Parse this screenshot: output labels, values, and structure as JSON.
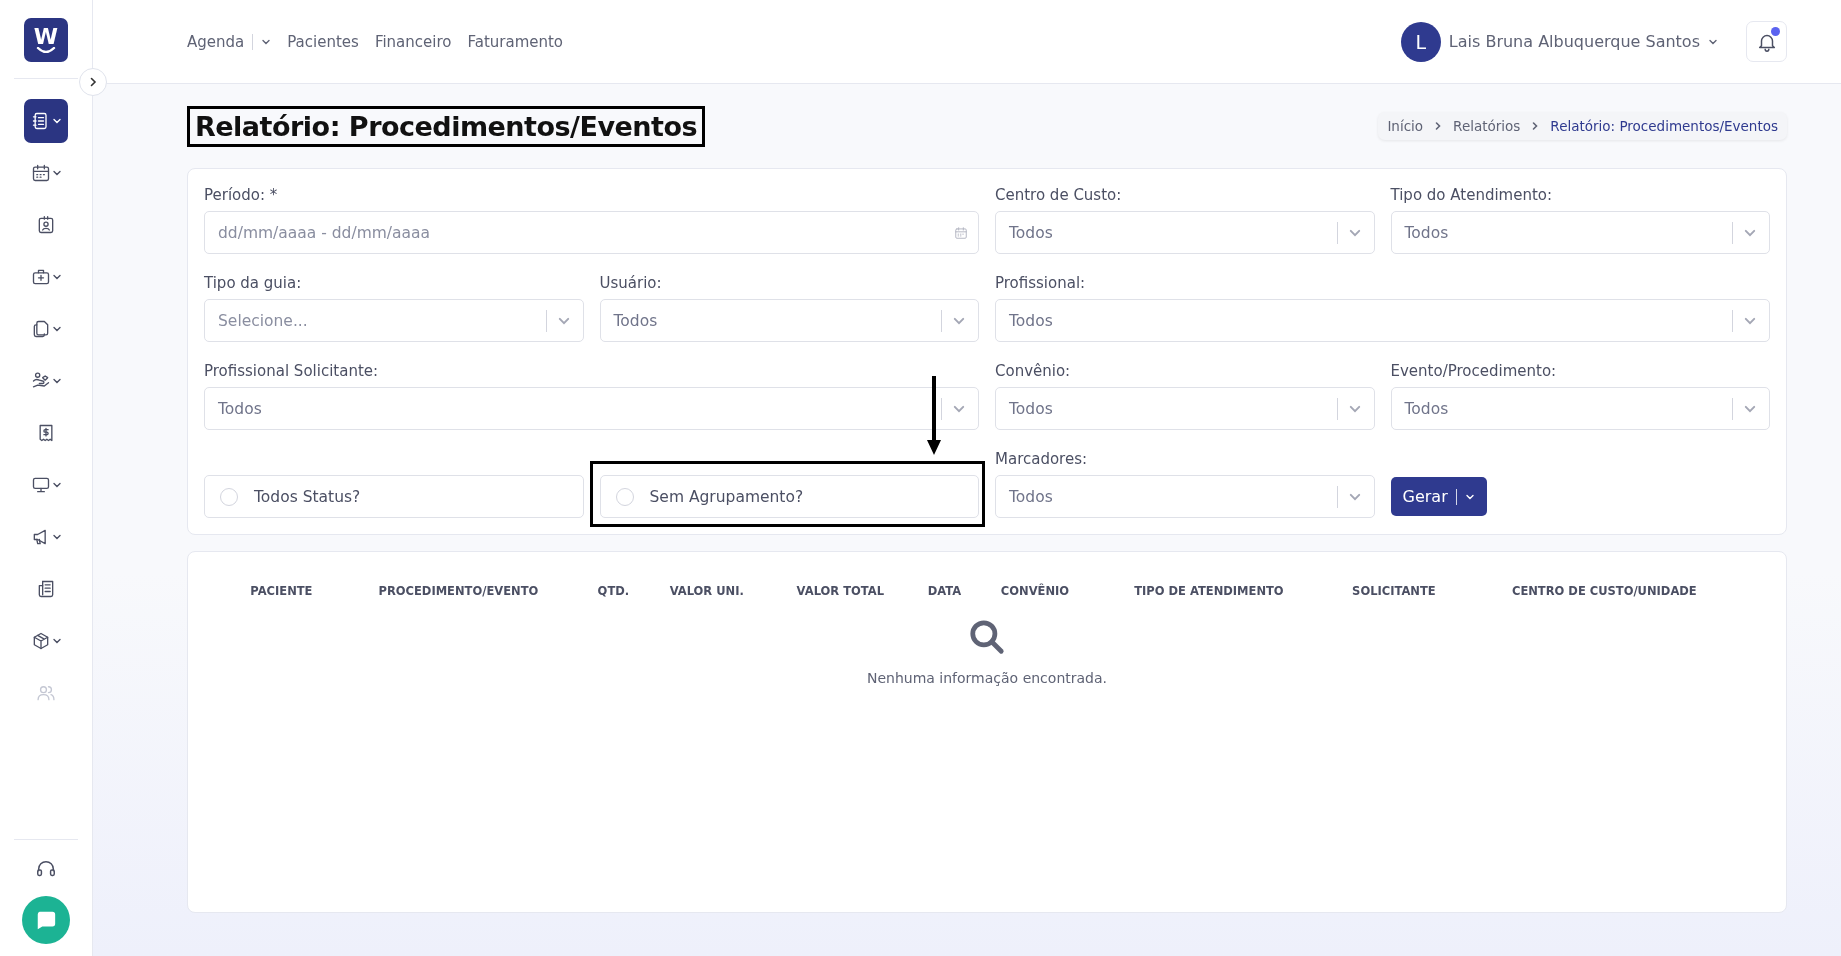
{
  "sidebar": {
    "logo": "W",
    "items": [
      {
        "selected": true,
        "submenu": true,
        "disabled": false
      },
      {
        "selected": false,
        "submenu": true,
        "disabled": false
      },
      {
        "selected": false,
        "submenu": false,
        "disabled": false
      },
      {
        "selected": false,
        "submenu": true,
        "disabled": false
      },
      {
        "selected": false,
        "submenu": true,
        "disabled": false
      },
      {
        "selected": false,
        "submenu": true,
        "disabled": false
      },
      {
        "selected": false,
        "submenu": false,
        "disabled": false
      },
      {
        "selected": false,
        "submenu": true,
        "disabled": false
      },
      {
        "selected": false,
        "submenu": true,
        "disabled": false
      },
      {
        "selected": false,
        "submenu": false,
        "disabled": false
      },
      {
        "selected": false,
        "submenu": true,
        "disabled": false
      },
      {
        "selected": false,
        "submenu": false,
        "disabled": true
      }
    ]
  },
  "nav": [
    {
      "label": "Agenda",
      "dropdown": true
    },
    {
      "label": "Pacientes",
      "dropdown": false
    },
    {
      "label": "Financeiro",
      "dropdown": false
    },
    {
      "label": "Faturamento",
      "dropdown": false
    }
  ],
  "user": {
    "initial": "L",
    "name": "Lais Bruna Albuquerque Santos"
  },
  "notifications": {
    "unread": true
  },
  "page": {
    "title": "Relatório: Procedimentos/Eventos",
    "highlighted": true
  },
  "breadcrumb": [
    {
      "label": "Início",
      "current": false
    },
    {
      "label": "Relatórios",
      "current": false
    },
    {
      "label": "Relatório: Procedimentos/Eventos",
      "current": true
    }
  ],
  "filters": [
    [
      {
        "kind": "date",
        "label": "Período: *",
        "placeholder": "dd/mm/aaaa - dd/mm/aaaa"
      },
      {
        "kind": "select",
        "label": "Centro de Custo:",
        "value": "Todos"
      },
      {
        "kind": "select",
        "label": "Tipo do Atendimento:",
        "value": "Todos"
      }
    ],
    [
      {
        "kind": "select",
        "label": "Tipo da guia:",
        "placeholder": "Selecione..."
      },
      {
        "kind": "select",
        "label": "Usuário:",
        "value": "Todos"
      },
      {
        "kind": "select",
        "label": "Profissional:",
        "value": "Todos"
      }
    ],
    [
      {
        "kind": "select",
        "label": "Profissional Solicitante:",
        "value": "Todos"
      },
      {
        "kind": "select",
        "label": "Convênio:",
        "value": "Todos"
      },
      {
        "kind": "select",
        "label": "Evento/Procedimento:",
        "value": "Todos"
      }
    ],
    [
      {
        "kind": "checkbox",
        "label": "Todos Status?",
        "checked": false,
        "highlighted": false
      },
      {
        "kind": "checkbox",
        "label": "Sem Agrupamento?",
        "checked": false,
        "highlighted": true
      },
      {
        "kind": "select",
        "label": "Marcadores:",
        "value": "Todos"
      },
      {
        "kind": "button",
        "label": "Gerar"
      }
    ]
  ],
  "table": {
    "columns": [
      "PACIENTE",
      "PROCEDIMENTO/EVENTO",
      "QTD.",
      "VALOR UNI.",
      "VALOR TOTAL",
      "DATA",
      "CONVÊNIO",
      "TIPO DE ATENDIMENTO",
      "SOLICITANTE",
      "CENTRO DE CUSTO/UNIDADE"
    ],
    "empty_message": "Nenhuma informação encontrada."
  }
}
